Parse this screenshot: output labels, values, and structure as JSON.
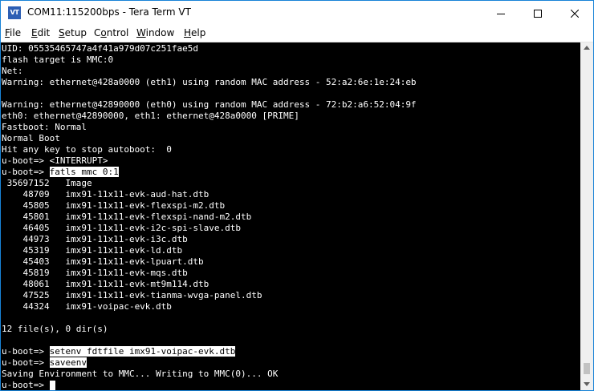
{
  "window": {
    "title": "COM11:115200bps - Tera Term VT",
    "icon_text": "VT",
    "accent_color": "#1883d7"
  },
  "menu": {
    "items": [
      {
        "pre": "",
        "key": "F",
        "post": "ile"
      },
      {
        "pre": "",
        "key": "E",
        "post": "dit"
      },
      {
        "pre": "",
        "key": "S",
        "post": "etup"
      },
      {
        "pre": "C",
        "key": "o",
        "post": "ntrol"
      },
      {
        "pre": "",
        "key": "W",
        "post": "indow"
      },
      {
        "pre": "",
        "key": "H",
        "post": "elp"
      }
    ]
  },
  "terminal": {
    "prompt": "u-boot=> ",
    "lines": [
      {
        "text": "UID: 05535465747a4f41a979d07c251fae5d"
      },
      {
        "text": "flash target is MMC:0"
      },
      {
        "text": "Net:"
      },
      {
        "text": "Warning: ethernet@428a0000 (eth1) using random MAC address - 52:a2:6e:1e:24:eb"
      },
      {
        "text": ""
      },
      {
        "text": "Warning: ethernet@42890000 (eth0) using random MAC address - 72:b2:a6:52:04:9f"
      },
      {
        "text": "eth0: ethernet@42890000, eth1: ethernet@428a0000 [PRIME]"
      },
      {
        "text": "Fastboot: Normal"
      },
      {
        "text": "Normal Boot"
      },
      {
        "text": "Hit any key to stop autoboot:  0"
      },
      {
        "text": "u-boot=> <INTERRUPT>"
      },
      {
        "prompt": true,
        "cmd": "fatls mmc 0:1"
      },
      {
        "text": " 35697152   Image"
      },
      {
        "text": "    48709   imx91-11x11-evk-aud-hat.dtb"
      },
      {
        "text": "    45805   imx91-11x11-evk-flexspi-m2.dtb"
      },
      {
        "text": "    45801   imx91-11x11-evk-flexspi-nand-m2.dtb"
      },
      {
        "text": "    46405   imx91-11x11-evk-i2c-spi-slave.dtb"
      },
      {
        "text": "    44973   imx91-11x11-evk-i3c.dtb"
      },
      {
        "text": "    45319   imx91-11x11-evk-ld.dtb"
      },
      {
        "text": "    45403   imx91-11x11-evk-lpuart.dtb"
      },
      {
        "text": "    45819   imx91-11x11-evk-mqs.dtb"
      },
      {
        "text": "    48061   imx91-11x11-evk-mt9m114.dtb"
      },
      {
        "text": "    47525   imx91-11x11-evk-tianma-wvga-panel.dtb"
      },
      {
        "text": "    44324   imx91-voipac-evk.dtb"
      },
      {
        "text": ""
      },
      {
        "text": "12 file(s), 0 dir(s)"
      },
      {
        "text": ""
      },
      {
        "prompt": true,
        "cmd": "setenv fdtfile imx91-voipac-evk.dtb"
      },
      {
        "prompt": true,
        "cmd": "saveenv"
      },
      {
        "text": "Saving Environment to MMC... Writing to MMC(0)... OK"
      },
      {
        "prompt": true,
        "cmd": "",
        "cursor": true
      }
    ]
  }
}
